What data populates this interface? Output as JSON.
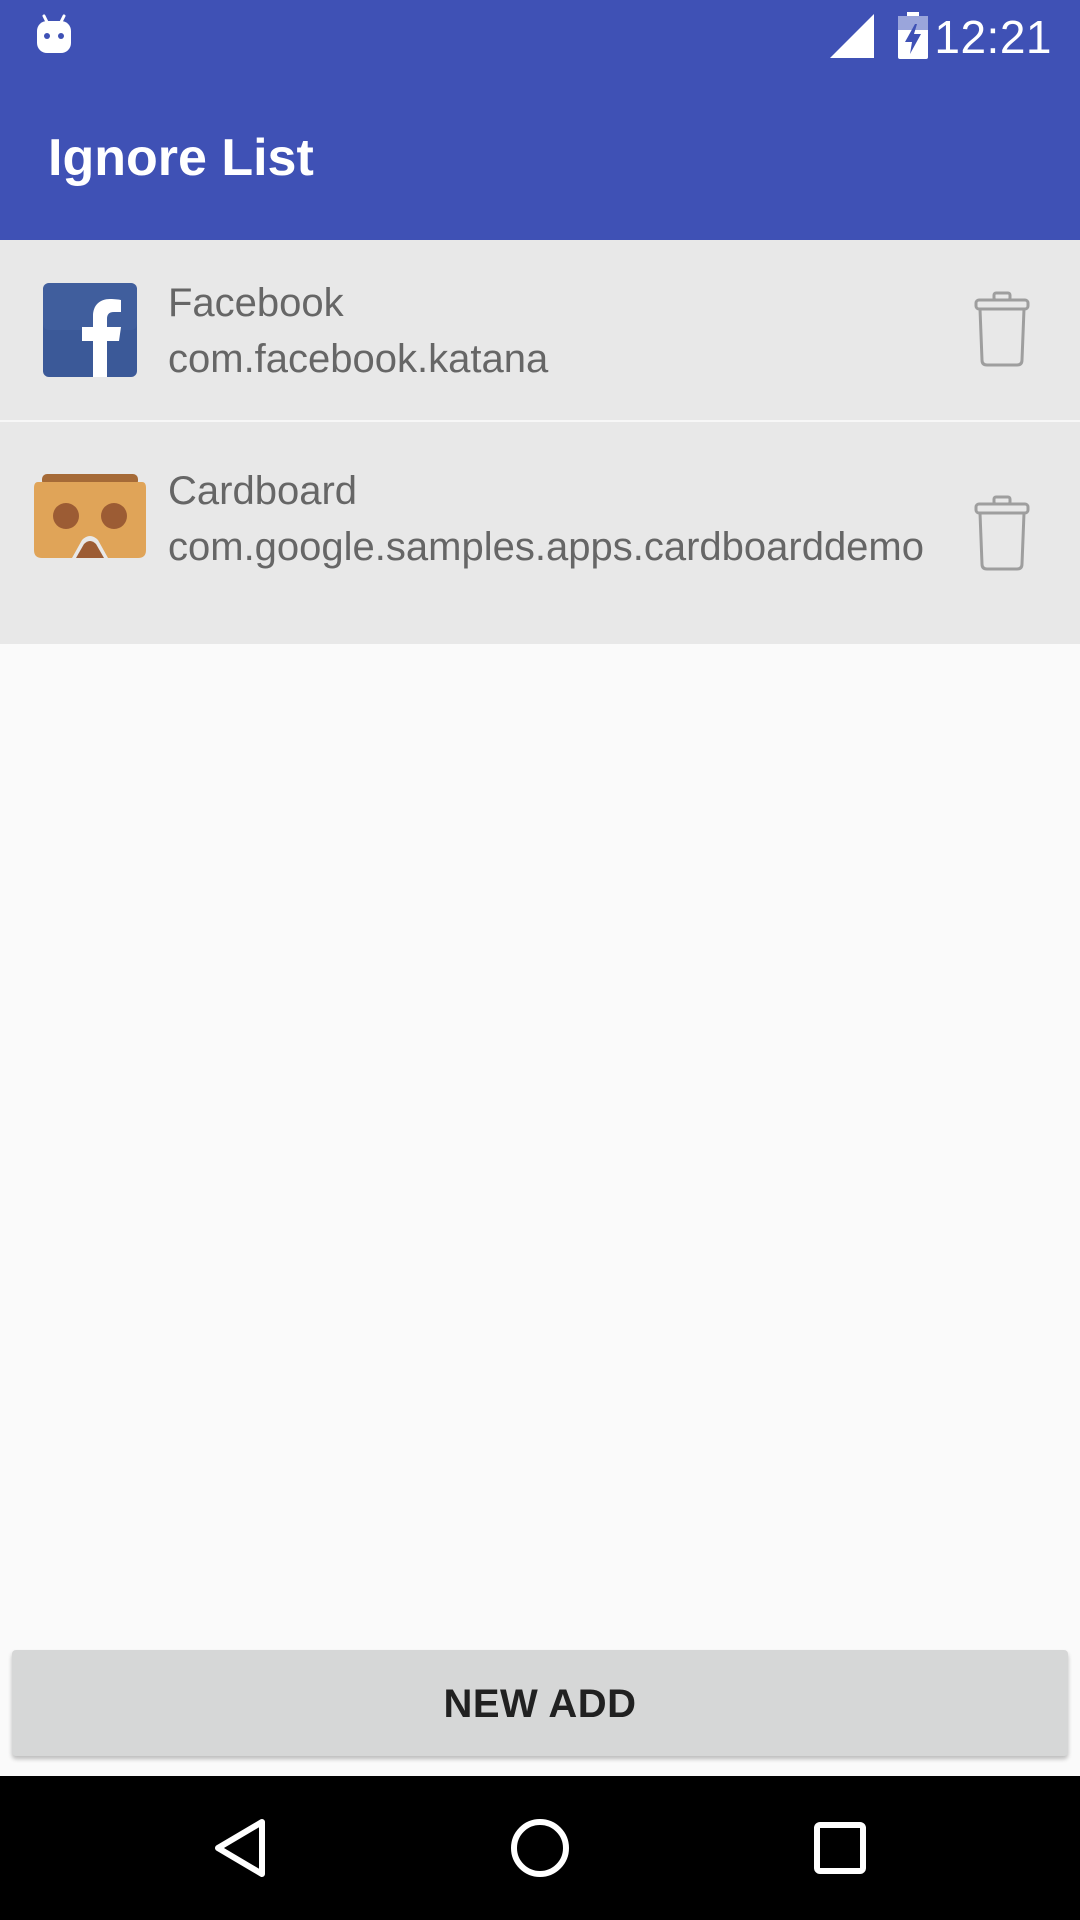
{
  "status_bar": {
    "time": "12:21",
    "icons": [
      "android-notification-icon",
      "signal-icon",
      "battery-charging-icon"
    ]
  },
  "app_bar": {
    "title": "Ignore List"
  },
  "ignore_list": [
    {
      "name": "Facebook",
      "package": "com.facebook.katana",
      "icon": "facebook-icon",
      "action_icon": "trash-icon"
    },
    {
      "name": "Cardboard",
      "package": "com.google.samples.apps.cardboarddemo",
      "icon": "cardboard-icon",
      "action_icon": "trash-icon"
    }
  ],
  "new_add_button": {
    "label": "NEW ADD"
  },
  "nav_bar": {
    "icons": [
      "back-icon",
      "home-icon",
      "recents-icon"
    ]
  },
  "colors": {
    "primary": "#3f51b5",
    "list_row_bg": "#e8e8e8",
    "page_bg": "#fafafa",
    "button_bg": "#d6d7d7",
    "facebook_blue": "#3b5998",
    "cardboard_orange": "#e0a458"
  }
}
